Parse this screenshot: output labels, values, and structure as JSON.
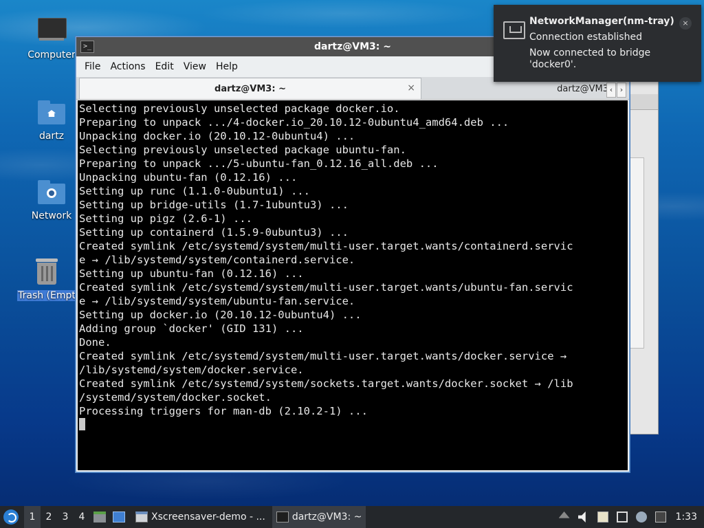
{
  "desktop": {
    "icons": [
      {
        "label": "Computer"
      },
      {
        "label": "dartz"
      },
      {
        "label": "Network"
      },
      {
        "label": "Trash (Empt"
      }
    ]
  },
  "window": {
    "title": "dartz@VM3: ~",
    "menu": [
      "File",
      "Actions",
      "Edit",
      "View",
      "Help"
    ],
    "tabs": [
      {
        "label": "dartz@VM3: ~",
        "close": "×"
      },
      {
        "label": "dartz@VM3"
      }
    ],
    "tab_arrows": [
      "‹",
      "›"
    ],
    "terminal_lines": [
      "Selecting previously unselected package docker.io.",
      "Preparing to unpack .../4-docker.io_20.10.12-0ubuntu4_amd64.deb ...",
      "Unpacking docker.io (20.10.12-0ubuntu4) ...",
      "Selecting previously unselected package ubuntu-fan.",
      "Preparing to unpack .../5-ubuntu-fan_0.12.16_all.deb ...",
      "Unpacking ubuntu-fan (0.12.16) ...",
      "Setting up runc (1.1.0-0ubuntu1) ...",
      "Setting up bridge-utils (1.7-1ubuntu3) ...",
      "Setting up pigz (2.6-1) ...",
      "Setting up containerd (1.5.9-0ubuntu3) ...",
      "Created symlink /etc/systemd/system/multi-user.target.wants/containerd.servic",
      "e → /lib/systemd/system/containerd.service.",
      "Setting up ubuntu-fan (0.12.16) ...",
      "Created symlink /etc/systemd/system/multi-user.target.wants/ubuntu-fan.servic",
      "e → /lib/systemd/system/ubuntu-fan.service.",
      "Setting up docker.io (20.10.12-0ubuntu4) ...",
      "Adding group `docker' (GID 131) ...",
      "Done.",
      "Created symlink /etc/systemd/system/multi-user.target.wants/docker.service →",
      "/lib/systemd/system/docker.service.",
      "Created symlink /etc/systemd/system/sockets.target.wants/docker.socket → /lib",
      "/systemd/system/docker.socket.",
      "Processing triggers for man-db (2.10.2-1) ..."
    ]
  },
  "notification": {
    "title": "NetworkManager(nm-tray)",
    "line1": "Connection established",
    "line2": "Now connected to bridge 'docker0'.",
    "close": "×"
  },
  "taskbar": {
    "workspaces": [
      "1",
      "2",
      "3",
      "4"
    ],
    "tasks": [
      {
        "label": "Xscreensaver-demo - ..."
      },
      {
        "label": "dartz@VM3: ~"
      }
    ],
    "clock": "1:33"
  }
}
